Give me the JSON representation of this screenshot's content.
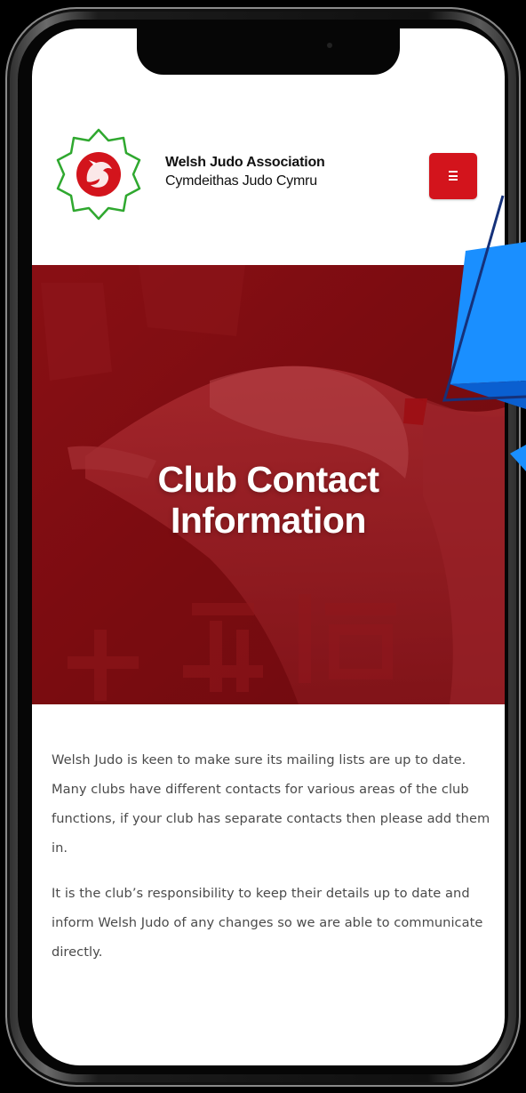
{
  "brand": {
    "name_en": "Welsh Judo Association",
    "name_cy": "Cymdeithas Judo Cymru"
  },
  "menu": {
    "icon": "hamburger-menu-icon"
  },
  "hero": {
    "title_line1": "Club Contact",
    "title_line2": "Information"
  },
  "content": {
    "paragraph1": "Welsh Judo is keen to make sure its mailing lists are up to date. Many clubs have different contacts for various areas of the club functions, if your club has separate contacts then please add them in.",
    "paragraph2": "It is the club’s responsibility to keep their details up to date and inform Welsh Judo of any changes so we are able to communicate directly."
  },
  "colors": {
    "accent_red": "#d3141c",
    "hero_red": "#7d0d12",
    "logo_green": "#2fa82f",
    "deco_blue": "#1a8fff"
  }
}
